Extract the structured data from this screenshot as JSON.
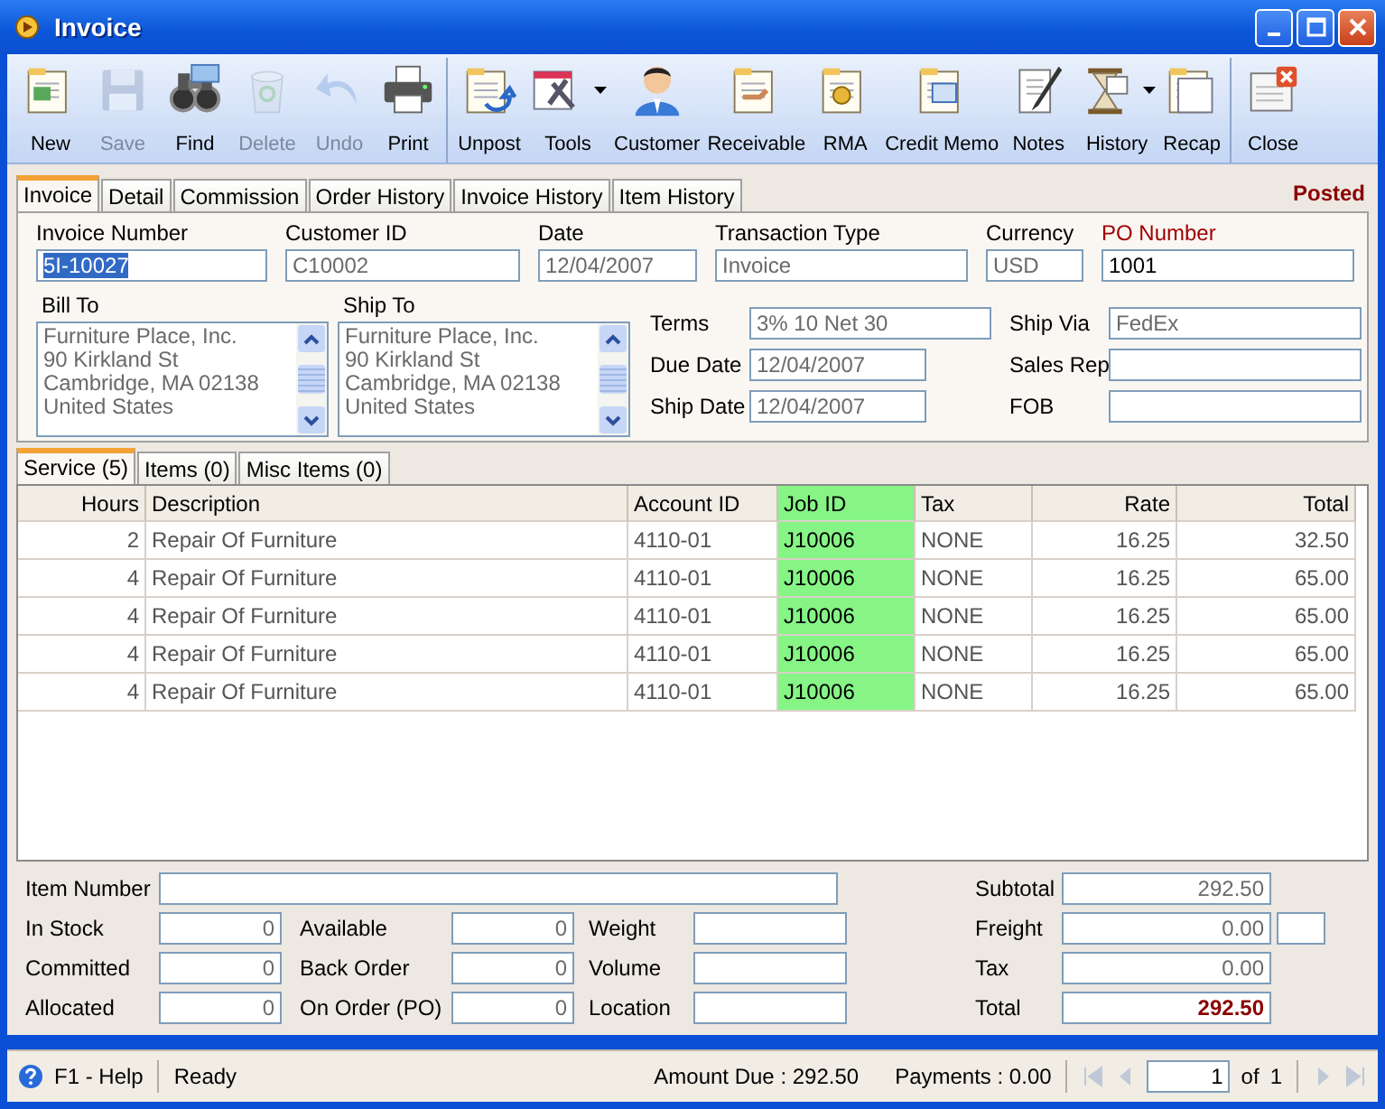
{
  "window": {
    "title": "Invoice"
  },
  "toolbar": [
    {
      "label": "New",
      "disabled": false,
      "dropdown": false,
      "group_end": false
    },
    {
      "label": "Save",
      "disabled": true,
      "dropdown": false,
      "group_end": false
    },
    {
      "label": "Find",
      "disabled": false,
      "dropdown": false,
      "group_end": false
    },
    {
      "label": "Delete",
      "disabled": true,
      "dropdown": false,
      "group_end": false
    },
    {
      "label": "Undo",
      "disabled": true,
      "dropdown": false,
      "group_end": false
    },
    {
      "label": "Print",
      "disabled": false,
      "dropdown": false,
      "group_end": true
    },
    {
      "label": "Unpost",
      "disabled": false,
      "dropdown": false,
      "group_end": false
    },
    {
      "label": "Tools",
      "disabled": false,
      "dropdown": true,
      "group_end": false
    },
    {
      "label": "Customer",
      "disabled": false,
      "dropdown": false,
      "group_end": false
    },
    {
      "label": "Receivable",
      "disabled": false,
      "dropdown": false,
      "group_end": false
    },
    {
      "label": "RMA",
      "disabled": false,
      "dropdown": false,
      "group_end": false
    },
    {
      "label": "Credit Memo",
      "disabled": false,
      "dropdown": false,
      "group_end": false
    },
    {
      "label": "Notes",
      "disabled": false,
      "dropdown": false,
      "group_end": false
    },
    {
      "label": "History",
      "disabled": false,
      "dropdown": true,
      "group_end": false
    },
    {
      "label": "Recap",
      "disabled": false,
      "dropdown": false,
      "group_end": true
    },
    {
      "label": "Close",
      "disabled": false,
      "dropdown": false,
      "group_end": false
    }
  ],
  "tabs": [
    {
      "label": "Invoice",
      "selected": true
    },
    {
      "label": "Detail",
      "selected": false
    },
    {
      "label": "Commission",
      "selected": false
    },
    {
      "label": "Order History",
      "selected": false
    },
    {
      "label": "Invoice History",
      "selected": false
    },
    {
      "label": "Item History",
      "selected": false
    }
  ],
  "status": "Posted",
  "header_fields": [
    {
      "label": "Invoice Number",
      "value": "5I-10027",
      "emphasized": false,
      "readonly": false,
      "text_selected": true
    },
    {
      "label": "Customer ID",
      "value": "C10002",
      "emphasized": false,
      "readonly": true,
      "text_selected": false
    },
    {
      "label": "Date",
      "value": "12/04/2007",
      "emphasized": false,
      "readonly": true,
      "text_selected": false
    },
    {
      "label": "Transaction Type",
      "value": "Invoice",
      "emphasized": false,
      "readonly": true,
      "text_selected": false
    },
    {
      "label": "Currency",
      "value": "USD",
      "emphasized": false,
      "readonly": true,
      "text_selected": false
    },
    {
      "label": "PO Number",
      "value": "1001",
      "emphasized": true,
      "readonly": false,
      "text_selected": false
    }
  ],
  "bill_to": {
    "label": "Bill To",
    "lines": [
      "Furniture Place, Inc.",
      "90 Kirkland St",
      "Cambridge, MA 02138",
      "United States"
    ]
  },
  "ship_to": {
    "label": "Ship To",
    "lines": [
      "Furniture Place, Inc.",
      "90 Kirkland St",
      "Cambridge, MA 02138",
      "United States"
    ]
  },
  "terms_fields": [
    {
      "label": "Terms",
      "value": "3% 10 Net 30"
    },
    {
      "label": "Due Date",
      "value": "12/04/2007"
    },
    {
      "label": "Ship Date",
      "value": "12/04/2007"
    }
  ],
  "shipping_fields": [
    {
      "label": "Ship Via",
      "value": "FedEx"
    },
    {
      "label": "Sales Rep"
    },
    {
      "label": "FOB"
    }
  ],
  "line_tabs": [
    {
      "label": "Service (5)",
      "selected": true
    },
    {
      "label": "Items (0)",
      "selected": false
    },
    {
      "label": "Misc Items (0)",
      "selected": false
    }
  ],
  "table": {
    "columns": [
      {
        "label": "Hours",
        "highlighted": false
      },
      {
        "label": "Description",
        "highlighted": false
      },
      {
        "label": "Account ID",
        "highlighted": false
      },
      {
        "label": "Job ID",
        "highlighted": true
      },
      {
        "label": "Tax",
        "highlighted": false
      },
      {
        "label": "Rate",
        "highlighted": false
      },
      {
        "label": "Total",
        "highlighted": false
      }
    ],
    "rows": [
      [
        "2",
        "Repair Of Furniture",
        "4110-01",
        "J10006",
        "NONE",
        "16.25",
        "32.50"
      ],
      [
        "4",
        "Repair Of Furniture",
        "4110-01",
        "J10006",
        "NONE",
        "16.25",
        "65.00"
      ],
      [
        "4",
        "Repair Of Furniture",
        "4110-01",
        "J10006",
        "NONE",
        "16.25",
        "65.00"
      ],
      [
        "4",
        "Repair Of Furniture",
        "4110-01",
        "J10006",
        "NONE",
        "16.25",
        "65.00"
      ],
      [
        "4",
        "Repair Of Furniture",
        "4110-01",
        "J10006",
        "NONE",
        "16.25",
        "65.00"
      ]
    ]
  },
  "item_number": {
    "label": "Item Number"
  },
  "stock_rows": [
    [
      {
        "label": "In Stock",
        "value": "0"
      },
      {
        "label": "Available",
        "value": "0"
      },
      {
        "label": "Weight"
      }
    ],
    [
      {
        "label": "Committed",
        "value": "0"
      },
      {
        "label": "Back Order",
        "value": "0"
      },
      {
        "label": "Volume"
      }
    ],
    [
      {
        "label": "Allocated",
        "value": "0"
      },
      {
        "label": "On Order (PO)",
        "value": "0"
      },
      {
        "label": "Location"
      }
    ]
  ],
  "totals": [
    {
      "label": "Subtotal",
      "value": "292.50",
      "kind": "plain"
    },
    {
      "label": "Freight",
      "value": "0.00",
      "kind": "with-extra"
    },
    {
      "label": "Tax",
      "value": "0.00",
      "kind": "plain"
    },
    {
      "label": "Total",
      "value": "292.50",
      "kind": "grand"
    }
  ],
  "status_bar": {
    "help": "F1 - Help",
    "state": "Ready",
    "amount_due": "Amount Due : 292.50",
    "payments": "Payments : 0.00",
    "page": "1",
    "of_label": "of",
    "page_count": "1",
    "nav": [
      {
        "kind": "first",
        "disabled": true
      },
      {
        "kind": "prev",
        "disabled": true
      },
      {
        "kind": "next",
        "disabled": true
      },
      {
        "kind": "last",
        "disabled": true
      }
    ]
  }
}
